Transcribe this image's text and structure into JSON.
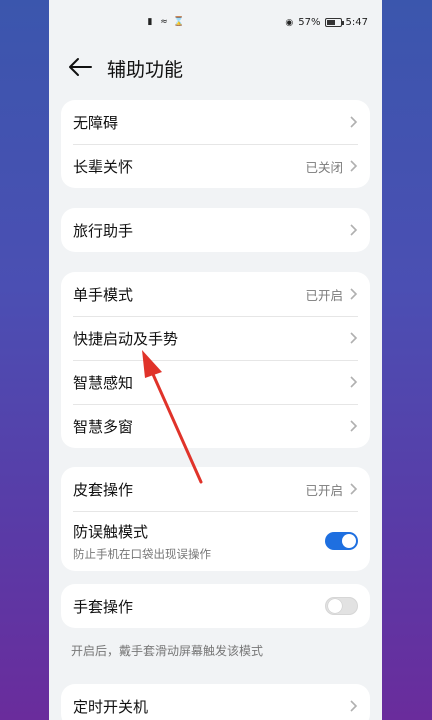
{
  "status_bar": {
    "battery": "57%",
    "time": "5:47"
  },
  "header": {
    "title": "辅助功能"
  },
  "groups": [
    {
      "rows": [
        {
          "label": "无障碍",
          "value": ""
        },
        {
          "label": "长辈关怀",
          "value": "已关闭"
        }
      ]
    },
    {
      "rows": [
        {
          "label": "旅行助手",
          "value": ""
        }
      ]
    },
    {
      "rows": [
        {
          "label": "单手模式",
          "value": "已开启"
        },
        {
          "label": "快捷启动及手势",
          "value": ""
        },
        {
          "label": "智慧感知",
          "value": ""
        },
        {
          "label": "智慧多窗",
          "value": ""
        }
      ]
    },
    {
      "rows": [
        {
          "label": "皮套操作",
          "value": "已开启"
        }
      ],
      "toggle_row": {
        "label": "防误触模式",
        "sub": "防止手机在口袋出现误操作",
        "state": "on"
      }
    },
    {
      "toggle_row": {
        "label": "手套操作",
        "state": "off"
      }
    },
    {
      "rows": [
        {
          "label": "定时开关机",
          "value": ""
        }
      ]
    }
  ],
  "glove_note": "开启后，戴手套滑动屏幕触发该模式",
  "colors": {
    "accent": "#1e6fe0",
    "annotation_arrow": "#e0332a"
  }
}
